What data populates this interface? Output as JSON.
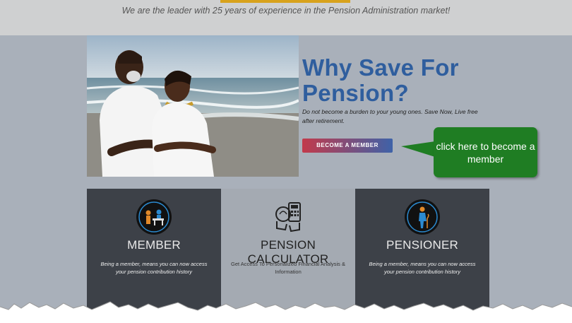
{
  "header": {
    "tagline": "We are the leader with 25 years of experience in the Pension Administration market!"
  },
  "hero": {
    "title": "Why Save For Pension?",
    "description": "Do not become a burden to your young ones. Save Now, Live free after retirement.",
    "button_label": "BECOME A MEMBER"
  },
  "callout": {
    "text": "click here to become a member"
  },
  "cards": [
    {
      "title": "MEMBER",
      "description": "Being a member, means you can now access your pension contribution history",
      "icon": "member-icon"
    },
    {
      "title": "PENSION CALCULATOR",
      "description": "Get Access To Personalized Financial Analysis & Information",
      "icon": "calculator-icon"
    },
    {
      "title": "PENSIONER",
      "description": "Being a member, means you can now access your pension contribution history",
      "icon": "pensioner-icon"
    }
  ],
  "colors": {
    "accent_blue": "#2f5e9e",
    "callout_green": "#1f7d23",
    "card_dark": "#3d4148",
    "top_line": "#d8a21c"
  }
}
